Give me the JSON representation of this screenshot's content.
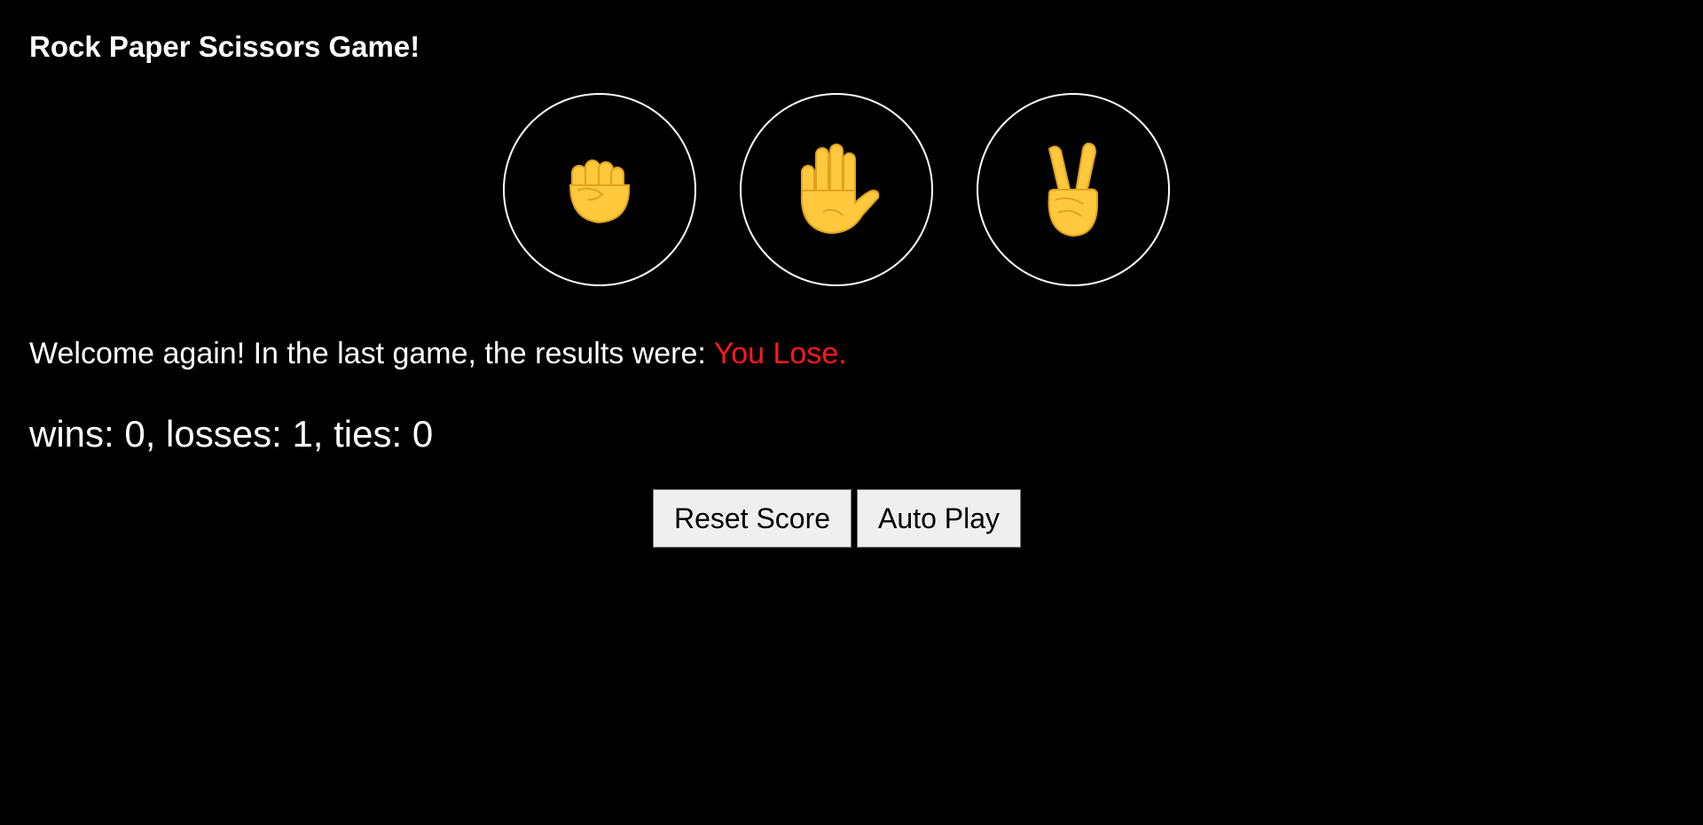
{
  "game": {
    "title": "Rock Paper Scissors Game!"
  },
  "moves": [
    {
      "name": "rock",
      "icon": "raised-fist-icon"
    },
    {
      "name": "paper",
      "icon": "raised-hand-icon"
    },
    {
      "name": "scissors",
      "icon": "victory-hand-icon"
    }
  ],
  "result": {
    "prefix": "Welcome again! In the last game, the results were:",
    "outcome": "You Lose.",
    "outcome_color": "#ff1a1a"
  },
  "score": {
    "text": "wins: 0, losses: 1, ties: 0",
    "wins": 0,
    "losses": 1,
    "ties": 0
  },
  "controls": {
    "reset_label": "Reset Score",
    "auto_play_label": "Auto Play"
  },
  "colors": {
    "background": "#000000",
    "emoji_skin": "#FFC83D",
    "emoji_outline": "#E0A31F"
  }
}
